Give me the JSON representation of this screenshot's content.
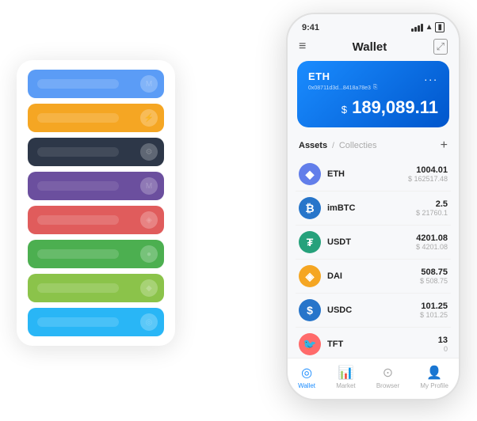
{
  "status_bar": {
    "time": "9:41"
  },
  "header": {
    "title": "Wallet"
  },
  "eth_card": {
    "label": "ETH",
    "address": "0x08711d3d...8418a78e3",
    "copy_icon": "⎘",
    "balance_currency": "$",
    "balance": "189,089.11",
    "dots": "..."
  },
  "assets": {
    "active_tab": "Assets",
    "separator": "/",
    "inactive_tab": "Collecties",
    "add_icon": "+"
  },
  "asset_list": [
    {
      "name": "ETH",
      "icon": "◆",
      "icon_class": "icon-eth",
      "amount": "1004.01",
      "usd": "$ 162517.48"
    },
    {
      "name": "imBTC",
      "icon": "₿",
      "icon_class": "icon-imbtc",
      "amount": "2.5",
      "usd": "$ 21760.1"
    },
    {
      "name": "USDT",
      "icon": "₮",
      "icon_class": "icon-usdt",
      "amount": "4201.08",
      "usd": "$ 4201.08"
    },
    {
      "name": "DAI",
      "icon": "◈",
      "icon_class": "icon-dai",
      "amount": "508.75",
      "usd": "$ 508.75"
    },
    {
      "name": "USDC",
      "icon": "$",
      "icon_class": "icon-usdc",
      "amount": "101.25",
      "usd": "$ 101.25"
    },
    {
      "name": "TFT",
      "icon": "🐦",
      "icon_class": "icon-tft",
      "amount": "13",
      "usd": "0"
    }
  ],
  "bottom_nav": [
    {
      "id": "wallet",
      "label": "Wallet",
      "icon": "◎",
      "active": true
    },
    {
      "id": "market",
      "label": "Market",
      "icon": "📊",
      "active": false
    },
    {
      "id": "browser",
      "label": "Browser",
      "icon": "⊙",
      "active": false
    },
    {
      "id": "profile",
      "label": "My Profile",
      "icon": "👤",
      "active": false
    }
  ],
  "bg_rows": [
    {
      "color": "row-blue",
      "label": ""
    },
    {
      "color": "row-orange",
      "label": ""
    },
    {
      "color": "row-dark",
      "label": ""
    },
    {
      "color": "row-purple",
      "label": ""
    },
    {
      "color": "row-red",
      "label": ""
    },
    {
      "color": "row-green",
      "label": ""
    },
    {
      "color": "row-light-green",
      "label": ""
    },
    {
      "color": "row-sky",
      "label": ""
    }
  ]
}
